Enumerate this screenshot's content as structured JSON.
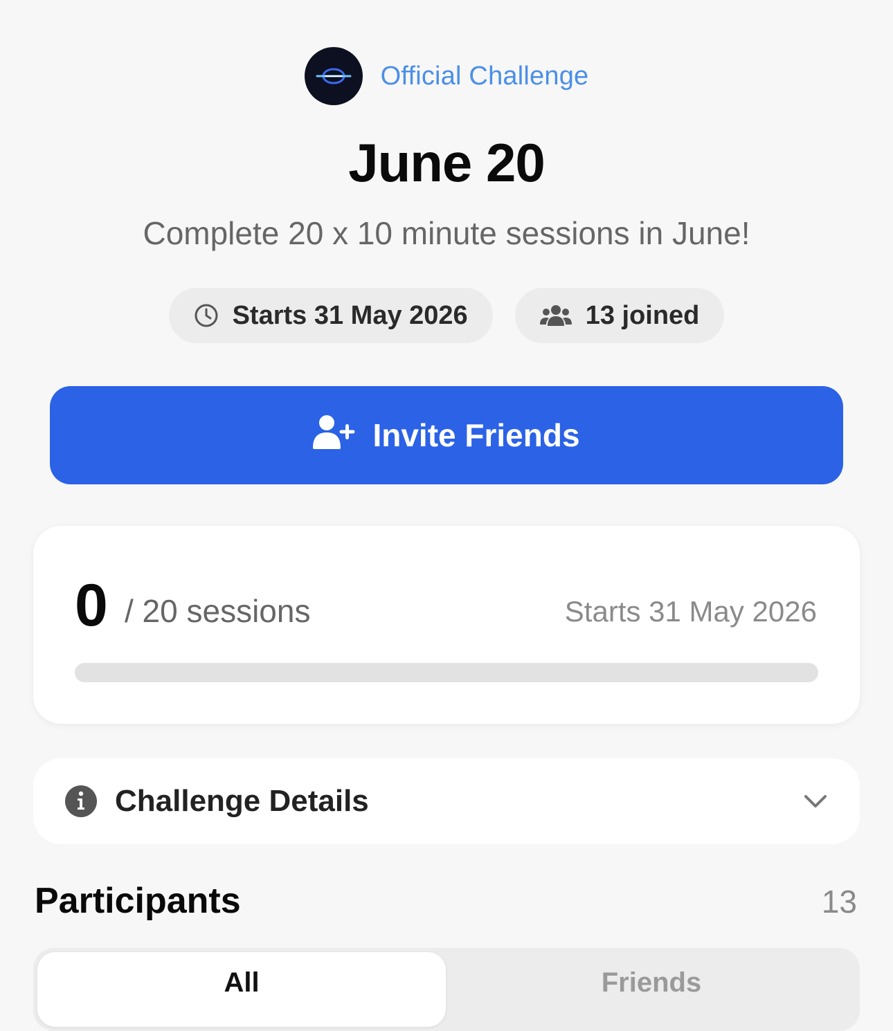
{
  "organizer": {
    "label": "Official Challenge",
    "logo_icon": "orbit-logo-icon"
  },
  "challenge": {
    "title": "June 20",
    "description": "Complete 20 x 10 minute sessions in June!"
  },
  "chips": {
    "start": {
      "icon": "clock-icon",
      "label": "Starts 31 May 2026"
    },
    "joined": {
      "icon": "users-icon",
      "label": "13 joined"
    }
  },
  "invite": {
    "icon": "user-plus-icon",
    "label": "Invite Friends"
  },
  "progress": {
    "count": "0",
    "goal_label": "/ 20 sessions",
    "start_label": "Starts 31 May 2026",
    "fraction": 0
  },
  "details": {
    "icon": "info-icon",
    "label": "Challenge Details"
  },
  "participants": {
    "title": "Participants",
    "count": "13",
    "tabs": [
      "All",
      "Friends"
    ],
    "selected_tab": "All"
  },
  "colors": {
    "accent": "#2b62e6",
    "link": "#4a8fe8",
    "background": "#f7f7f7"
  }
}
